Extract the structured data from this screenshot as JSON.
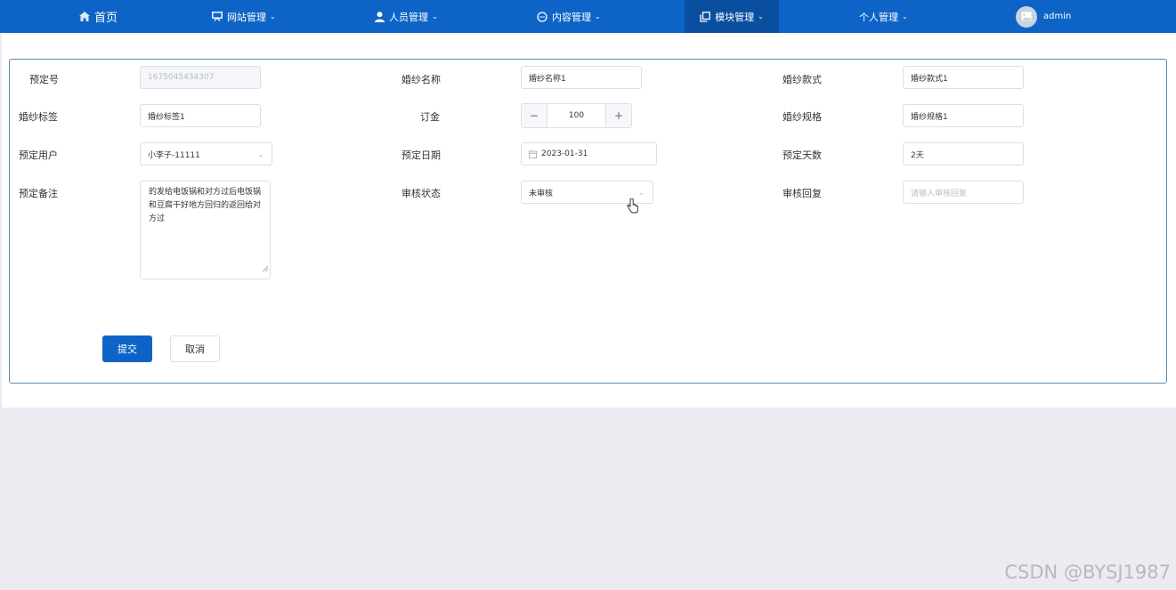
{
  "nav": {
    "home": "首页",
    "website_mgmt": "网站管理",
    "personnel_mgmt": "人员管理",
    "content_mgmt": "内容管理",
    "module_mgmt": "模块管理",
    "personal_mgmt": "个人管理",
    "username": "admin"
  },
  "form": {
    "booking_no": {
      "label": "预定号",
      "value": "1675045434307"
    },
    "gown_name": {
      "label": "婚纱名称",
      "value": "婚纱名称1"
    },
    "gown_style": {
      "label": "婚纱款式",
      "value": "婚纱款式1"
    },
    "gown_tag": {
      "label": "婚纱标签",
      "value": "婚纱标签1"
    },
    "deposit": {
      "label": "订金",
      "value": "100",
      "minus": "−",
      "plus": "+"
    },
    "gown_spec": {
      "label": "婚纱规格",
      "value": "婚纱规格1"
    },
    "booking_user": {
      "label": "预定用户",
      "value": "小李子-11111"
    },
    "booking_date": {
      "label": "预定日期",
      "value": "2023-01-31"
    },
    "booking_days": {
      "label": "预定天数",
      "value": "2天"
    },
    "booking_note": {
      "label": "预定备注",
      "value": "的发给电饭锅和对方过后电饭锅和豆腐干好地方回归的返回给对方过"
    },
    "review_status": {
      "label": "审核状态",
      "value": "未审核"
    },
    "review_reply": {
      "label": "审核回复",
      "placeholder": "请输入审核回复"
    }
  },
  "buttons": {
    "submit": "提交",
    "cancel": "取消"
  },
  "watermark": "CSDN @BYSJ1987",
  "colors": {
    "primary": "#0d64c6",
    "nav_active": "#0a4f9f",
    "background": "#ecebf1"
  }
}
